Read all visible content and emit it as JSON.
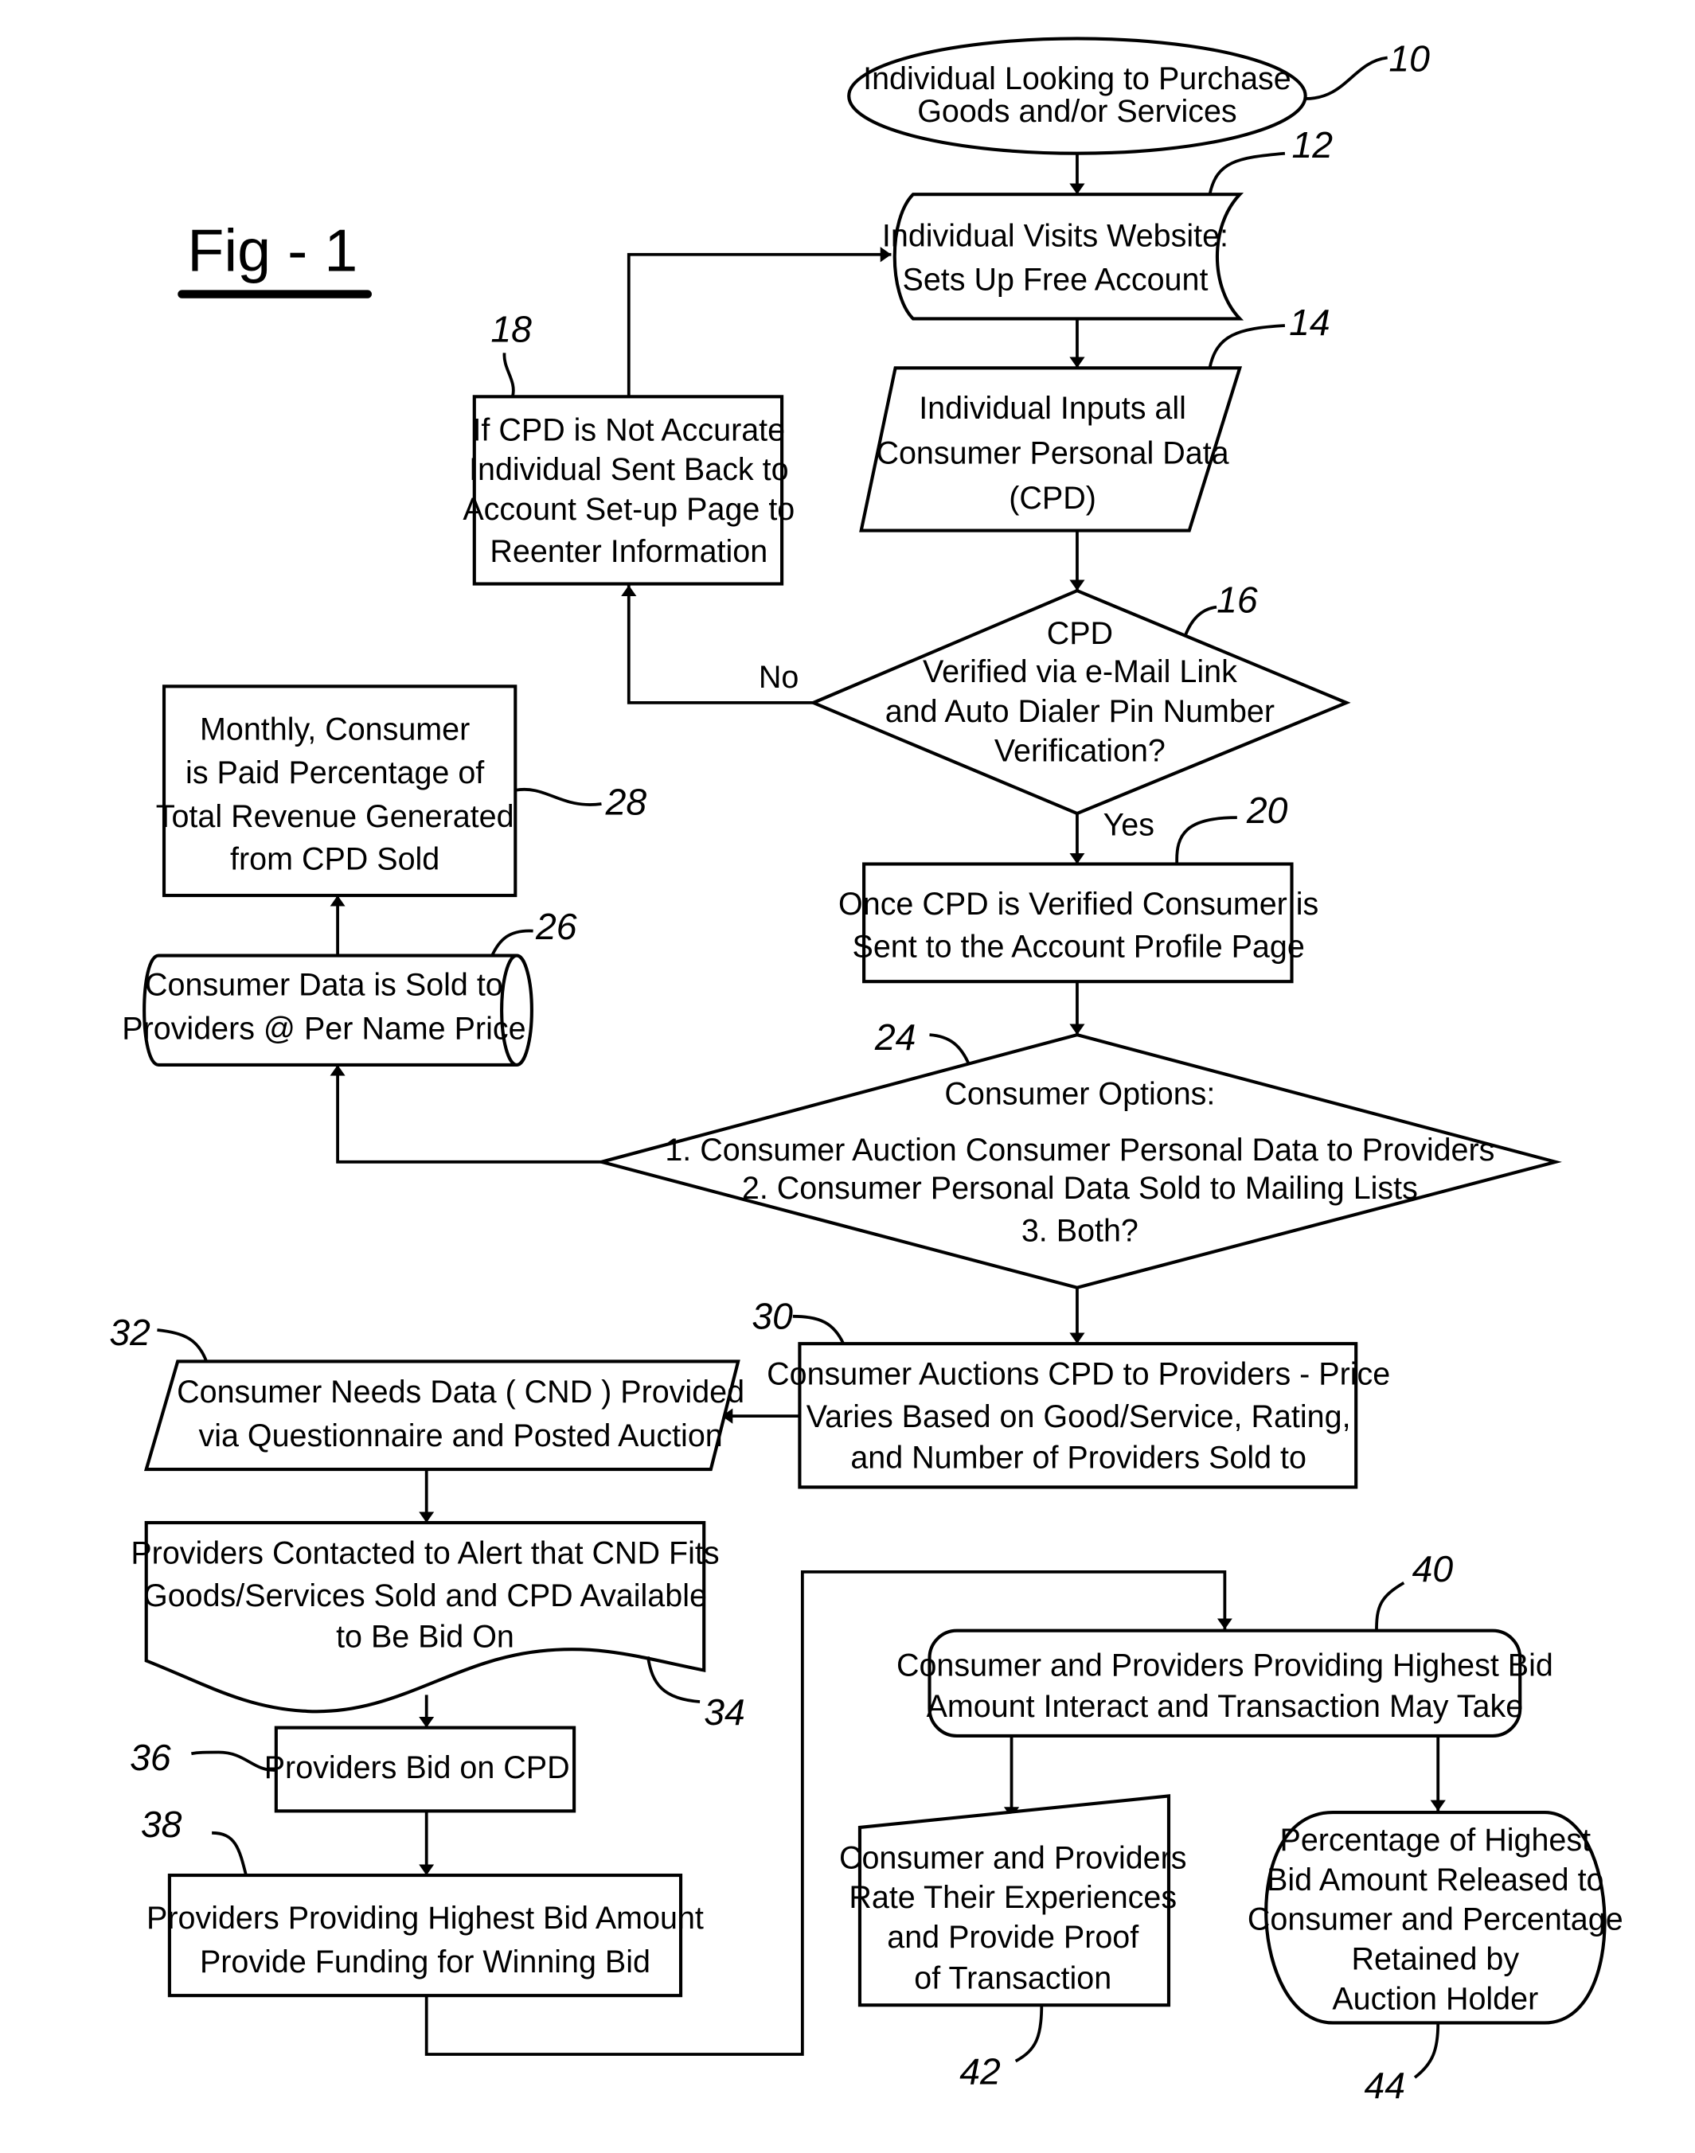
{
  "figure": {
    "title": "Fig - 1"
  },
  "nodes": {
    "n10": {
      "ref": "10",
      "lines": [
        "Individual Looking to Purchase",
        "Goods and/or Services"
      ]
    },
    "n12": {
      "ref": "12",
      "lines": [
        "Individual Visits Website:",
        "Sets Up Free Account"
      ]
    },
    "n14": {
      "ref": "14",
      "lines": [
        "Individual Inputs all",
        "Consumer Personal Data",
        "(CPD)"
      ]
    },
    "n16": {
      "ref": "16",
      "lines": [
        "CPD",
        "Verified via e-Mail Link",
        "and Auto Dialer Pin Number",
        "Verification?"
      ]
    },
    "n18": {
      "ref": "18",
      "lines": [
        "If CPD is Not Accurate",
        "Individual Sent Back to",
        "Account Set-up Page to",
        "Reenter Information"
      ]
    },
    "n20": {
      "ref": "20",
      "lines": [
        "Once CPD is Verified Consumer is",
        "Sent to the Account Profile Page"
      ]
    },
    "n24": {
      "ref": "24",
      "lines": [
        "Consumer Options:",
        "1. Consumer Auction Consumer Personal Data to Providers",
        "2. Consumer Personal Data Sold to Mailing Lists",
        "3. Both?"
      ]
    },
    "n26": {
      "ref": "26",
      "lines": [
        "Consumer Data is Sold to",
        "Providers @ Per Name Price"
      ]
    },
    "n28": {
      "ref": "28",
      "lines": [
        "Monthly, Consumer",
        "is Paid Percentage of",
        "Total Revenue Generated",
        "from CPD Sold"
      ]
    },
    "n30": {
      "ref": "30",
      "lines": [
        "Consumer Auctions CPD to Providers - Price",
        "Varies Based on Good/Service, Rating,",
        "and Number of Providers Sold to"
      ]
    },
    "n32": {
      "ref": "32",
      "lines": [
        "Consumer Needs Data ( CND ) Provided",
        "via Questionnaire and Posted Auction"
      ]
    },
    "n34": {
      "ref": "34",
      "lines": [
        "Providers Contacted to Alert that CND Fits",
        "Goods/Services Sold and CPD Available",
        "to Be Bid On"
      ]
    },
    "n36": {
      "ref": "36",
      "lines": [
        "Providers Bid on CPD"
      ]
    },
    "n38": {
      "ref": "38",
      "lines": [
        "Providers Providing Highest Bid Amount",
        "Provide Funding for Winning Bid"
      ]
    },
    "n40": {
      "ref": "40",
      "lines": [
        "Consumer and Providers Providing Highest Bid",
        "Amount Interact and Transaction May Take"
      ]
    },
    "n42": {
      "ref": "42",
      "lines": [
        "Consumer and Providers",
        "Rate Their Experiences",
        "and Provide Proof",
        "of Transaction"
      ]
    },
    "n44": {
      "ref": "44",
      "lines": [
        "Percentage of Highest",
        "Bid Amount Released to",
        "Consumer and Percentage",
        "Retained by",
        "Auction Holder"
      ]
    }
  },
  "edge_labels": {
    "no": "No",
    "yes": "Yes"
  }
}
